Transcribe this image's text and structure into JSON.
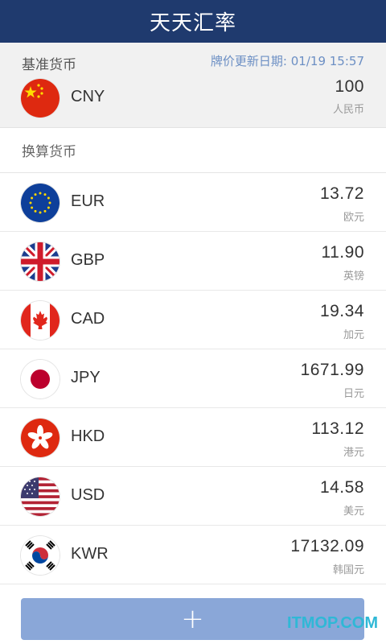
{
  "header": {
    "title": "天天汇率"
  },
  "base": {
    "section_label": "基准货币",
    "updated_label": "牌价更新日期:",
    "updated_value": "01/19 15:57",
    "currency": {
      "code": "CNY",
      "amount": "100",
      "name": "人民币",
      "flag": "china-flag-icon"
    }
  },
  "convert": {
    "section_label": "换算货币",
    "items": [
      {
        "code": "EUR",
        "amount": "13.72",
        "name": "欧元",
        "flag": "eu-flag-icon"
      },
      {
        "code": "GBP",
        "amount": "11.90",
        "name": "英镑",
        "flag": "uk-flag-icon"
      },
      {
        "code": "CAD",
        "amount": "19.34",
        "name": "加元",
        "flag": "canada-flag-icon"
      },
      {
        "code": "JPY",
        "amount": "1671.99",
        "name": "日元",
        "flag": "japan-flag-icon"
      },
      {
        "code": "HKD",
        "amount": "113.12",
        "name": "港元",
        "flag": "hongkong-flag-icon"
      },
      {
        "code": "USD",
        "amount": "14.58",
        "name": "美元",
        "flag": "usa-flag-icon"
      },
      {
        "code": "KWR",
        "amount": "17132.09",
        "name": "韩国元",
        "flag": "korea-flag-icon"
      }
    ]
  },
  "add_button": {
    "label": "+"
  },
  "watermark": "ITMOP.COM",
  "colors": {
    "header_bg": "#1f3a6e",
    "accent": "#8aa7d8",
    "updated_text": "#6c8fc4",
    "watermark": "#2fb8d6"
  }
}
